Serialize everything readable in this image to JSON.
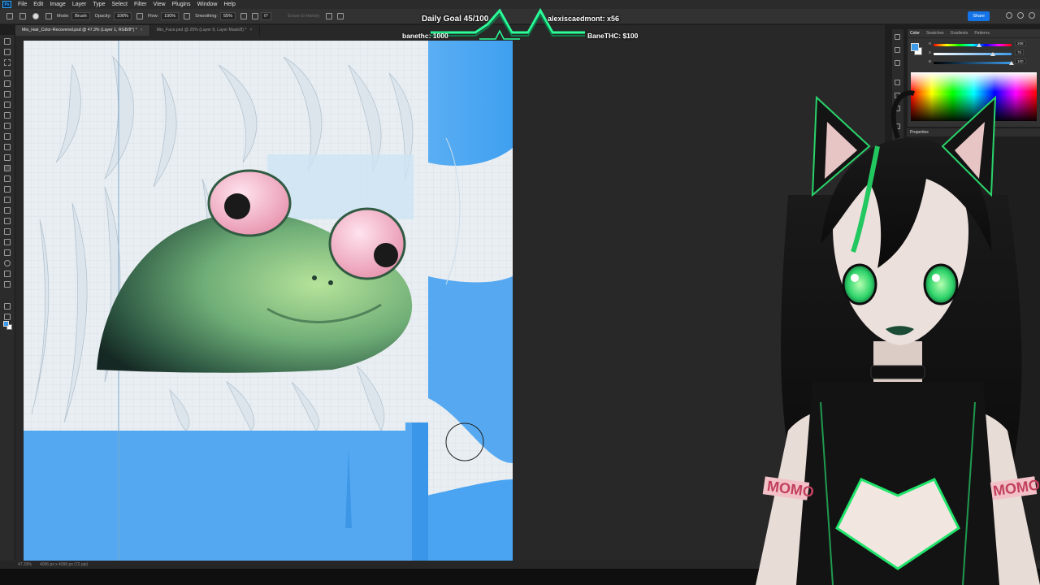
{
  "menubar": {
    "logo": "Ps",
    "items": [
      "File",
      "Edit",
      "Image",
      "Layer",
      "Type",
      "Select",
      "Filter",
      "View",
      "Plugins",
      "Window",
      "Help"
    ]
  },
  "options": {
    "mode_label": "Mode:",
    "mode_value": "Brush",
    "opacity_label": "Opacity:",
    "opacity_value": "100%",
    "flow_label": "Flow:",
    "flow_value": "100%",
    "smoothing_label": "Smoothing:",
    "smoothing_value": "55%",
    "angle_value": "0°",
    "erase_history": "Erase to History",
    "share_label": "Share"
  },
  "tabs": [
    {
      "label": "Mio_Hair_Color-Recovered.psd @ 47.3% (Layer 1, RGB/8*) *",
      "active": true
    },
    {
      "label": "Mio_Face.psd @ 25% (Layer 9, Layer Mask/8) *",
      "active": false
    }
  ],
  "status": {
    "zoom": "47.33%",
    "doc_size": "4096 px x 4096 px (72 ppi)"
  },
  "overlay": {
    "goal": "Daily Goal 45/100",
    "top_gifter": "alexiscaedmont: x56",
    "left_stat": "banethc: 1000",
    "right_stat": "BaneTHC: $100"
  },
  "color_panel": {
    "tabs": [
      "Color",
      "Swatches",
      "Gradients",
      "Patterns"
    ],
    "channels": [
      {
        "label": "H",
        "value": "208"
      },
      {
        "label": "S",
        "value": "75"
      },
      {
        "label": "B",
        "value": "100"
      }
    ],
    "foreground": "#3d9be9",
    "background": "#ffffff"
  },
  "properties_title": "Properties",
  "avatar": {
    "band_left": "MOMO",
    "band_right": "MOMO"
  }
}
